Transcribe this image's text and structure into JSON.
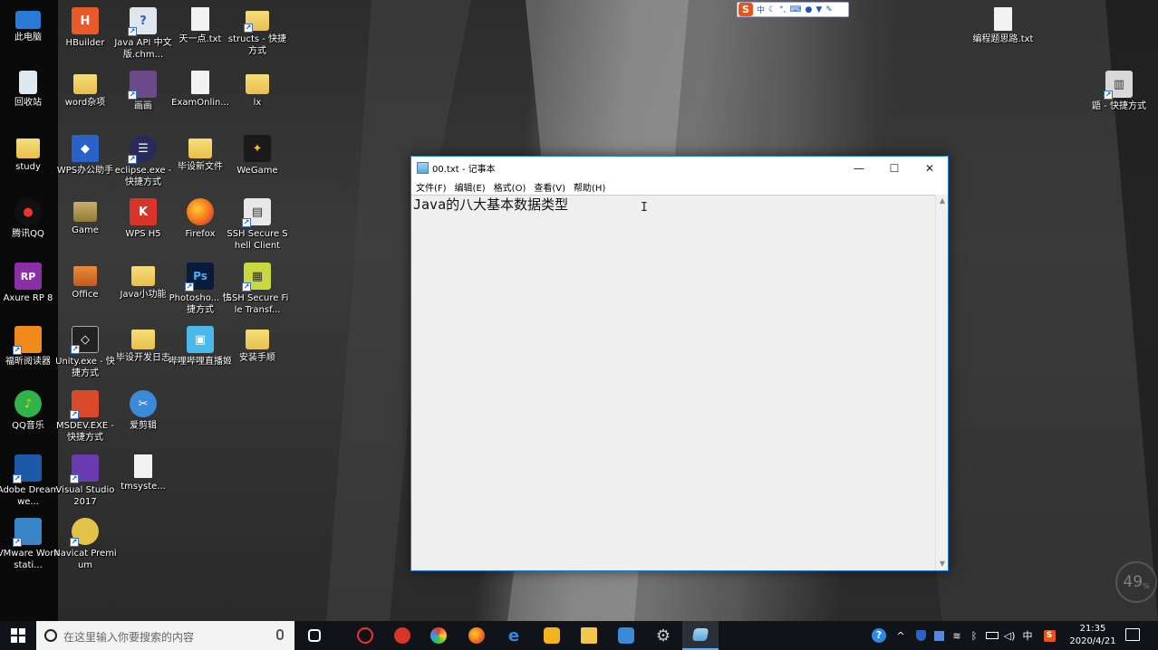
{
  "desktop": {
    "icons_col1": [
      "此电脑",
      "回收站",
      "study",
      "腾讯QQ",
      "Axure RP 8",
      "福昕阅读器",
      "QQ音乐",
      "Adobe Dreamwe...",
      "VMware Workstati..."
    ],
    "icons_col2": [
      "HBuilder",
      "word杂项",
      "WPS办公助手",
      "Game",
      "Office",
      "Unity.exe - 快捷方式",
      "MSDEV.EXE - 快捷方式",
      "Visual Studio 2017",
      "Navicat Premium"
    ],
    "icons_col3": [
      "Java API 中文版.chm...",
      "画画",
      "eclipse.exe - 快捷方式",
      "WPS H5",
      "Java小功能",
      "毕设开发日志",
      "爱剪辑",
      "tmsyste..."
    ],
    "icons_col4": [
      "天一点.txt",
      "ExamOnlin...",
      "毕设新文件",
      "Firefox",
      "Photosho... 快捷方式",
      "哔哩哔哩直播姬"
    ],
    "icons_col5": [
      "structs - 快捷方式",
      "lx",
      "WeGame",
      "SSH Secure Shell Client",
      "SSH Secure File Transf...",
      "安装手顺"
    ],
    "icon_right_top": "编程题思路.txt",
    "icon_right_2": "鼯 - 快捷方式"
  },
  "ime_bar": {
    "logo": "S",
    "lang": "中"
  },
  "notepad": {
    "title": "00.txt - 记事本",
    "menu": [
      "文件(F)",
      "编辑(E)",
      "格式(O)",
      "查看(V)",
      "帮助(H)"
    ],
    "content": "Java的八大基本数据类型",
    "min_btn": "—",
    "max_btn": "☐",
    "close_btn": "✕"
  },
  "overlay_timer": {
    "value": "49",
    "unit": "%"
  },
  "taskbar": {
    "search_placeholder": "在这里输入你要搜索的内容",
    "tray_lang": "中",
    "tray_s": "S",
    "time": "21:35",
    "date": "2020/4/21"
  }
}
